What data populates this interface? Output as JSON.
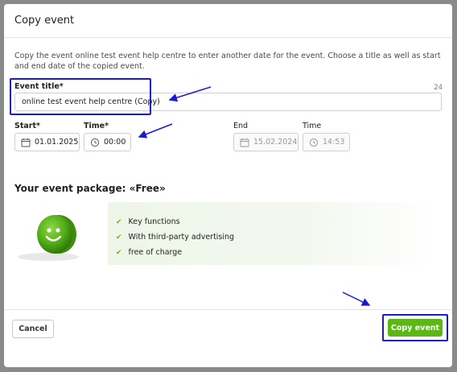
{
  "dialog": {
    "title": "Copy event",
    "intro": "Copy the event online test event help centre to enter another date for the event. Choose a title as well as start and end date of the copied event."
  },
  "form": {
    "event_title_label": "Event title*",
    "event_title_value": "online test event help centre (Copy)",
    "char_counter": "24",
    "start_label": "Start*",
    "start_value": "01.01.2025",
    "start_time_label": "Time*",
    "start_time_value": "00:00",
    "end_label": "End",
    "end_value": "15.02.2024",
    "end_time_label": "Time",
    "end_time_value": "14:53"
  },
  "package": {
    "title": "Your event package: «Free»",
    "features": [
      "Key functions",
      "With third-party advertising",
      "free of charge"
    ]
  },
  "footer": {
    "cancel_label": "Cancel",
    "copy_label": "Copy event"
  },
  "colors": {
    "accent_green": "#5cb615",
    "annotation_blue": "#1a1bd1"
  },
  "icons": {
    "calendar": "calendar-icon",
    "clock": "clock-icon",
    "check": "check-icon",
    "smiley": "smiley-ball-icon"
  }
}
